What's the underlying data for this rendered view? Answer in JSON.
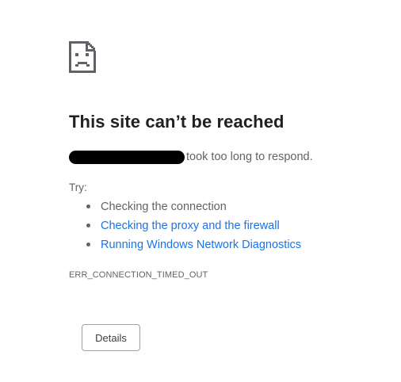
{
  "error_page": {
    "icon": "sad-page-icon",
    "title": "This site can’t be reached",
    "summary_suffix": "took too long to respond.",
    "try_label": "Try:",
    "suggestions": [
      {
        "label": "Checking the connection",
        "is_link": false
      },
      {
        "label": "Checking the proxy and the firewall",
        "is_link": true
      },
      {
        "label": "Running Windows Network Diagnostics",
        "is_link": true
      }
    ],
    "error_code": "ERR_CONNECTION_TIMED_OUT",
    "details_button_label": "Details"
  },
  "colors": {
    "title": "#202124",
    "body_text": "#5f6368",
    "link": "#1a73e8",
    "icon": "#5f6368",
    "redaction": "#000000",
    "button_border": "#9aa0a6"
  }
}
